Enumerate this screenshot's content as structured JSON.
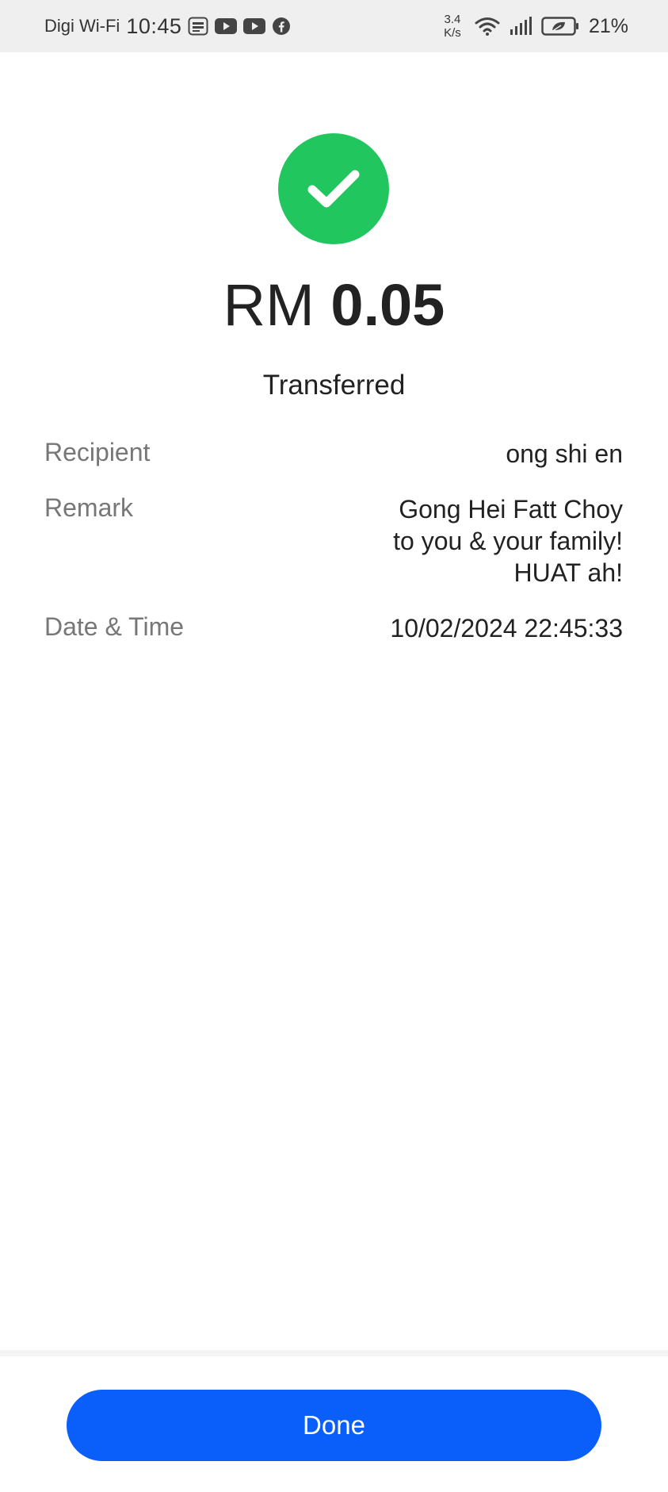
{
  "status_bar": {
    "carrier": "Digi Wi-Fi",
    "time": "10:45",
    "net_speed_value": "3.4",
    "net_speed_unit": "K/s",
    "battery": "21%",
    "notification_icons": [
      "touch-n-go-icon",
      "youtube-icon",
      "youtube-icon",
      "facebook-icon"
    ],
    "system_icons": [
      "wifi-icon",
      "signal-icon",
      "battery-icon"
    ]
  },
  "receipt": {
    "currency": "RM",
    "amount": "0.05",
    "status": "Transferred",
    "success_color": "#21c65f",
    "details": {
      "recipient_label": "Recipient",
      "recipient_value": "ong shi en",
      "remark_label": "Remark",
      "remark_value": "Gong Hei Fatt Choy\nto you & your family!\nHUAT ah!",
      "datetime_label": "Date & Time",
      "datetime_value": "10/02/2024 22:45:33"
    }
  },
  "actions": {
    "done_label": "Done",
    "accent": "#0a5ffa"
  }
}
